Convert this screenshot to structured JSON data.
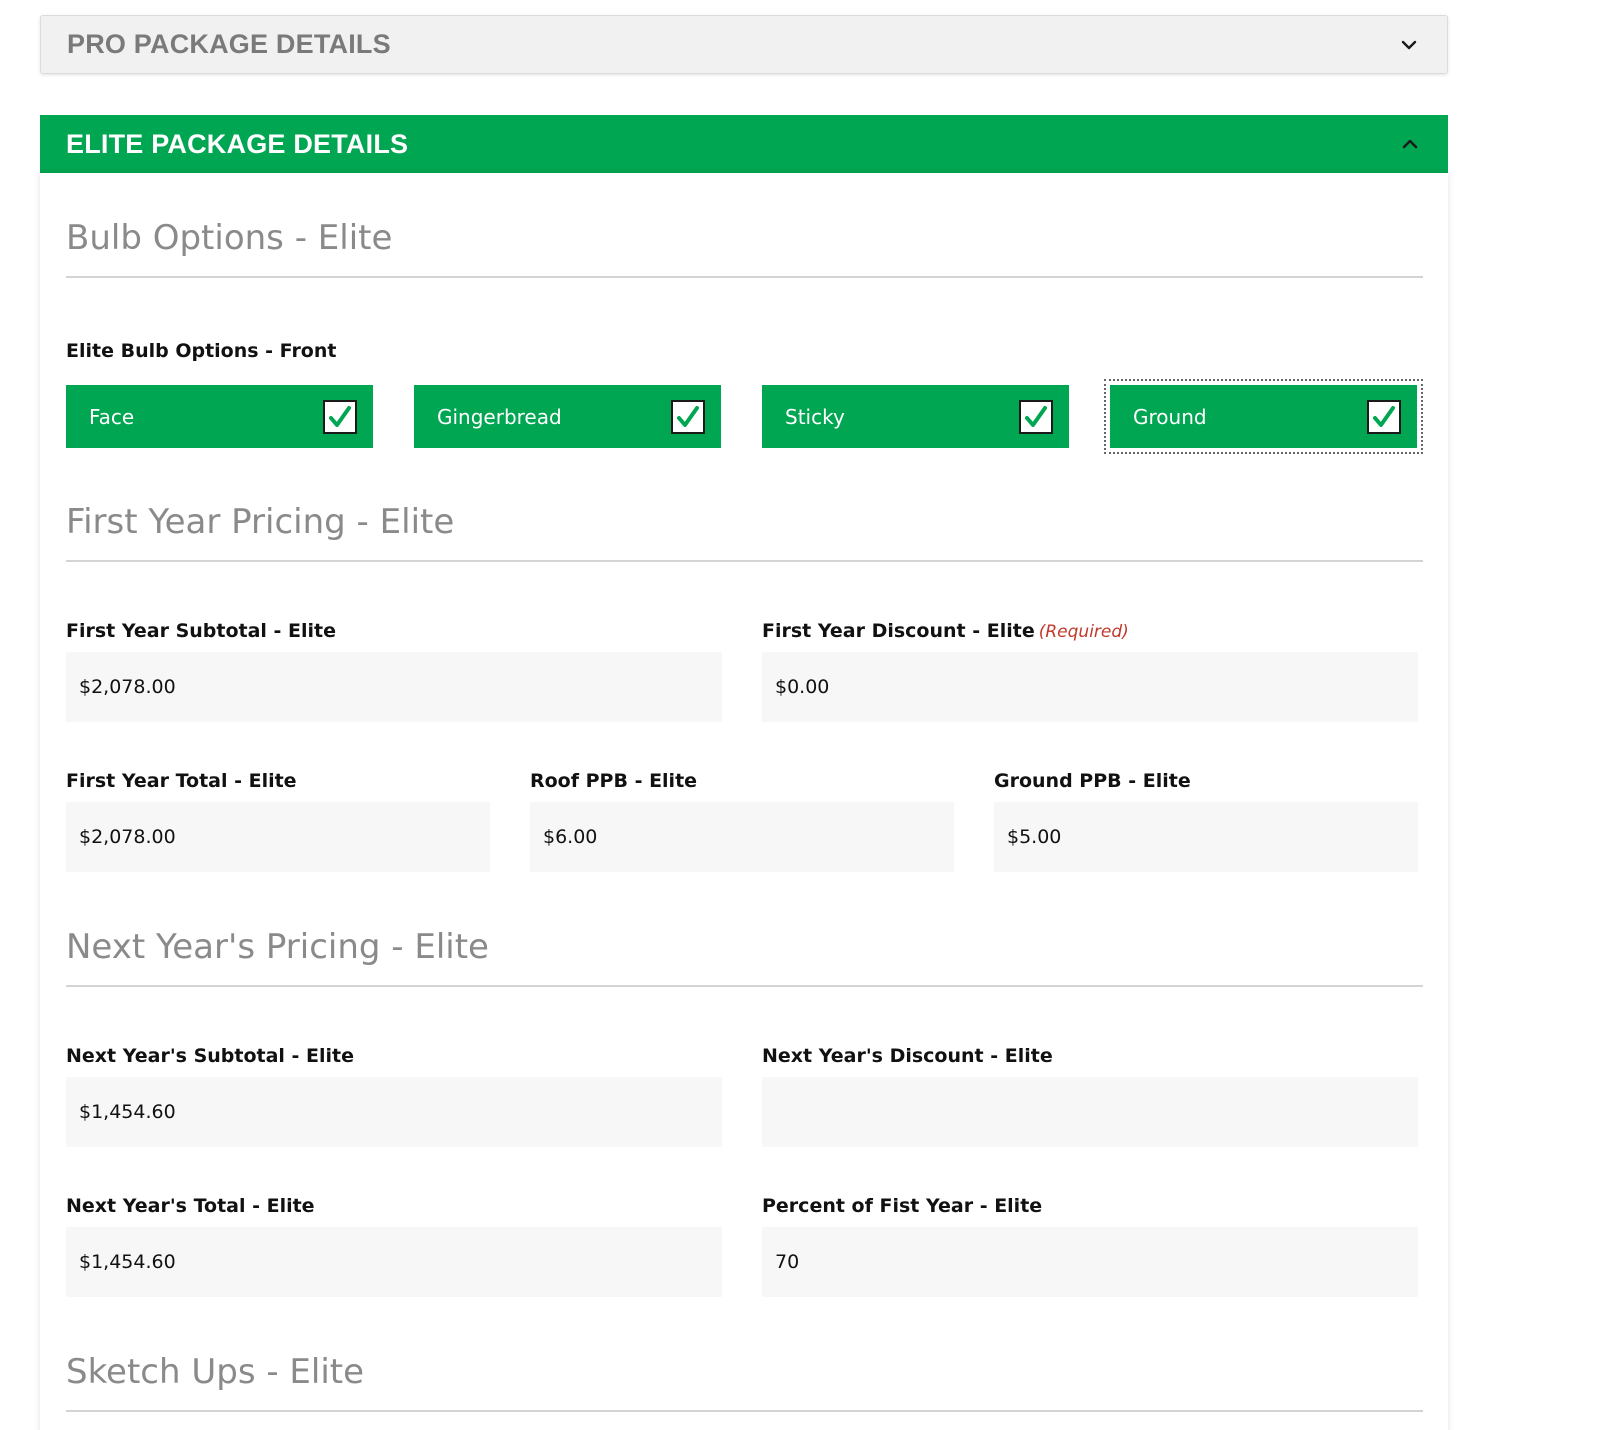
{
  "accordion": {
    "pro": {
      "title": "PRO PACKAGE DETAILS",
      "expanded": false
    },
    "elite": {
      "title": "ELITE PACKAGE DETAILS",
      "expanded": true
    }
  },
  "colors": {
    "accent": "#00a651",
    "required": "#c0392b"
  },
  "bulb_section": {
    "title": "Bulb Options - Elite",
    "group_label": "Elite Bulb Options - Front",
    "options": [
      {
        "label": "Face",
        "checked": true
      },
      {
        "label": "Gingerbread",
        "checked": true
      },
      {
        "label": "Sticky",
        "checked": true
      },
      {
        "label": "Ground",
        "checked": true
      }
    ]
  },
  "first_year": {
    "title": "First Year Pricing - Elite",
    "subtotal": {
      "label": "First Year Subtotal - Elite",
      "value": "$2,078.00"
    },
    "discount": {
      "label": "First Year Discount - Elite",
      "required": "(Required)",
      "value": "$0.00"
    },
    "total": {
      "label": "First Year Total - Elite",
      "value": "$2,078.00"
    },
    "roof_ppb": {
      "label": "Roof PPB - Elite",
      "value": "$6.00"
    },
    "ground_ppb": {
      "label": "Ground PPB - Elite",
      "value": "$5.00"
    }
  },
  "next_year": {
    "title": "Next Year's Pricing - Elite",
    "subtotal": {
      "label": "Next Year's Subtotal - Elite",
      "value": "$1,454.60"
    },
    "discount": {
      "label": "Next Year's Discount - Elite",
      "value": ""
    },
    "total": {
      "label": "Next Year's Total - Elite",
      "value": "$1,454.60"
    },
    "percent": {
      "label": "Percent of Fist Year - Elite",
      "value": "70"
    }
  },
  "sketch_section": {
    "title": "Sketch Ups - Elite"
  }
}
